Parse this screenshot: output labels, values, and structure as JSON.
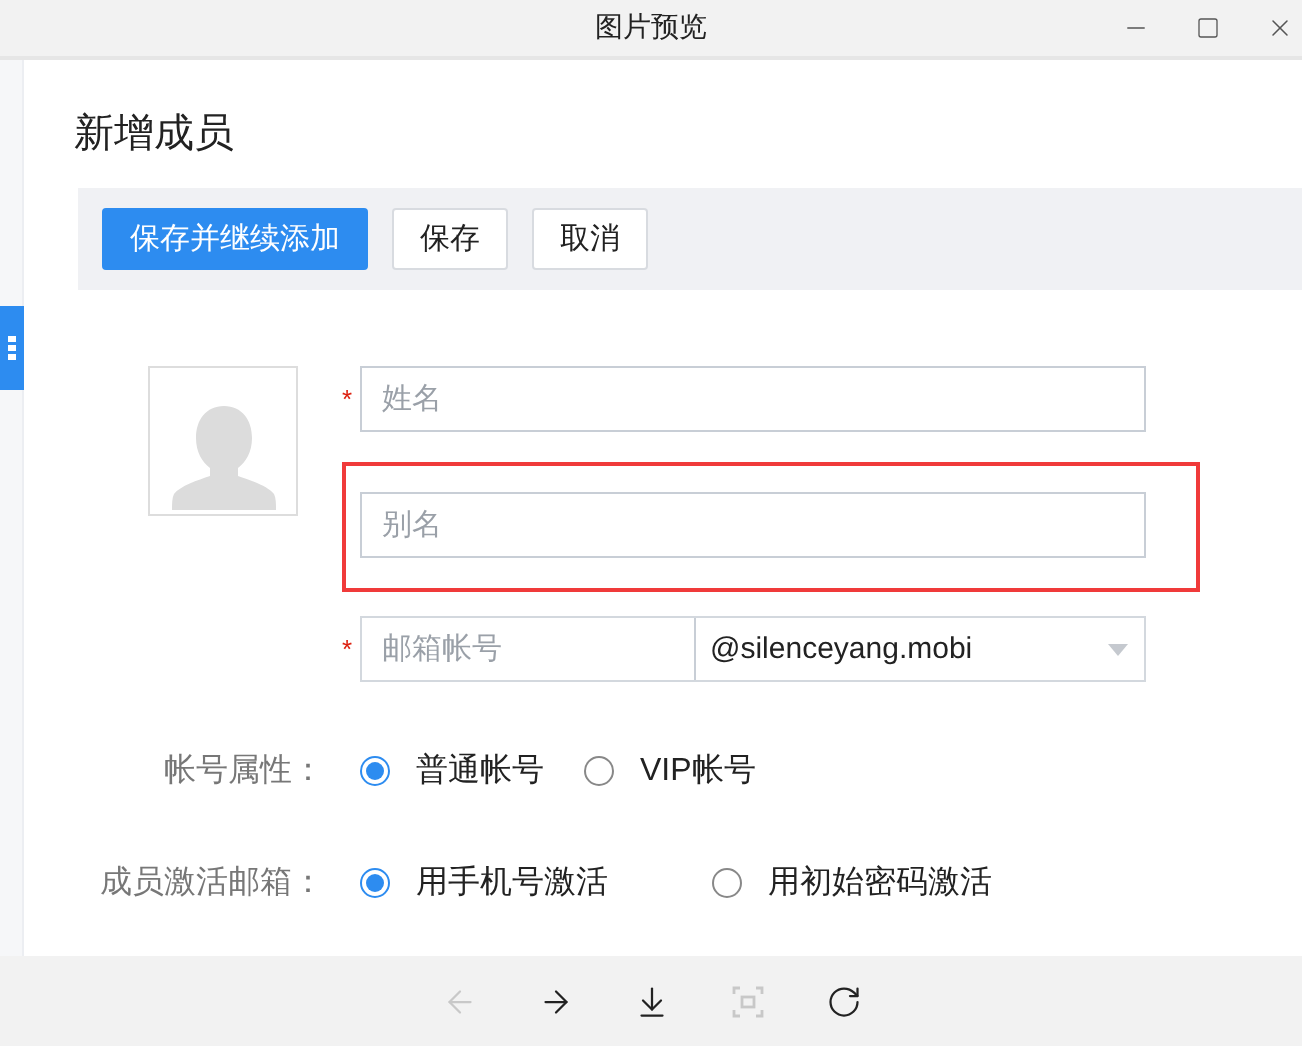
{
  "window": {
    "title": "图片预览"
  },
  "form": {
    "title": "新增成员",
    "actions": [
      {
        "label": "保存并继续添加",
        "kind": "primary"
      },
      {
        "label": "保存",
        "kind": "default"
      },
      {
        "label": "取消",
        "kind": "default"
      }
    ],
    "fields": [
      {
        "kind": "text",
        "placeholder": "姓名",
        "required_mark": "*",
        "highlighted": false
      },
      {
        "kind": "text",
        "placeholder": "别名",
        "highlighted": true
      },
      {
        "kind": "email",
        "placeholder": "邮箱帐号",
        "required_mark": "*",
        "highlighted": false,
        "domain": "@silenceyang.mobi"
      }
    ],
    "radio_groups": [
      {
        "label": "帐号属性：",
        "options": [
          {
            "label": "普通帐号",
            "selected": true
          },
          {
            "label": "VIP帐号",
            "selected": false
          }
        ]
      },
      {
        "label": "成员激活邮箱：",
        "options": [
          {
            "label": "用手机号激活",
            "selected": true
          },
          {
            "label": "用初始密码激活",
            "selected": false
          }
        ]
      }
    ]
  },
  "viewer_toolbar": [
    {
      "kind": "previous",
      "disabled": true
    },
    {
      "kind": "next",
      "disabled": false
    },
    {
      "kind": "download",
      "disabled": false
    },
    {
      "kind": "fit",
      "disabled": true
    },
    {
      "kind": "rotate",
      "disabled": false
    }
  ]
}
